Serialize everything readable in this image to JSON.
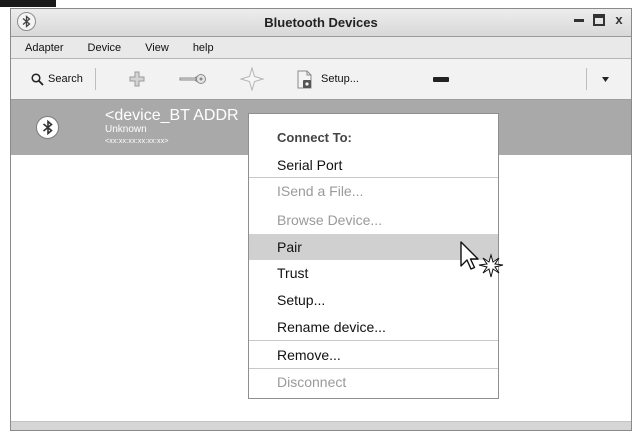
{
  "window": {
    "title": "Bluetooth Devices",
    "controls": [
      "minimize",
      "maximize",
      "close"
    ],
    "close_glyph": "x"
  },
  "menubar": {
    "items": [
      "Adapter",
      "Device",
      "View",
      "help"
    ]
  },
  "toolbar": {
    "search_label": "Search",
    "icons": [
      "search-icon",
      "add-device-icon",
      "key-icon",
      "star-icon",
      "setup-document-icon",
      "dash-icon",
      "chevron-down-icon"
    ],
    "setup_label": "Setup..."
  },
  "device": {
    "name": "<device_BT ADDR",
    "status": "Unknown",
    "address": "<xx:xx:xx:xx:xx:xx>",
    "icon": "bluetooth-icon"
  },
  "context_menu": {
    "header": "Connect To:",
    "items": [
      {
        "label": "Serial Port",
        "enabled": true
      },
      {
        "label": "ISend a File...",
        "enabled": false
      },
      {
        "label": "Browse Device...",
        "enabled": false
      },
      {
        "label": "Pair",
        "enabled": true,
        "highlighted": true
      },
      {
        "label": "Trust",
        "enabled": true
      },
      {
        "label": "Setup...",
        "enabled": true
      },
      {
        "label": "Rename device...",
        "enabled": true
      },
      {
        "label": "Remove...",
        "enabled": true
      },
      {
        "label": "Disconnect",
        "enabled": false
      }
    ]
  },
  "colors": {
    "selected_row": "#a9a9a9",
    "menu_highlight": "#d0d0d0",
    "disabled_text": "#9a9a9a"
  }
}
